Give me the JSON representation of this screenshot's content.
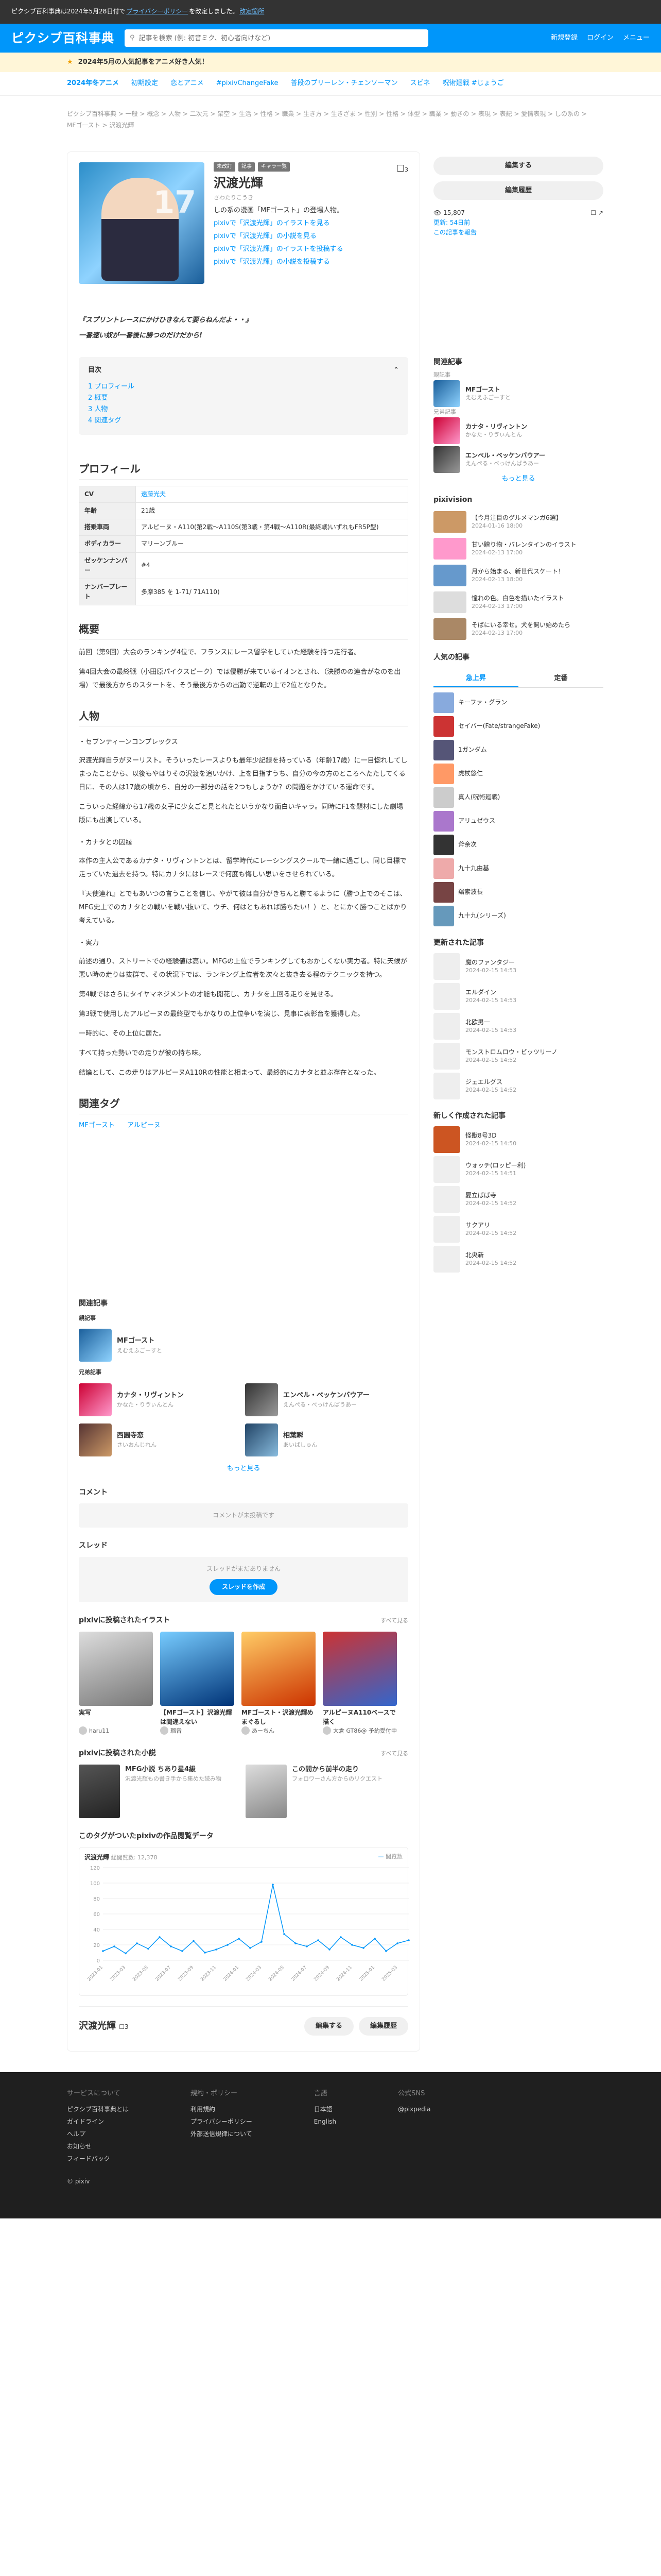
{
  "topbar": {
    "text1": "ピクシブ百科事典は2024年5月28日付で",
    "link1": "プライバシーポリシー",
    "text2": "を改定しました。",
    "link2": "改定箇所"
  },
  "header": {
    "logo": "ピクシブ百科事典",
    "search_placeholder": "記事を検索 (例: 初音ミク、初心者向けなど)",
    "links": [
      "新規登録",
      "ログイン",
      "メニュー"
    ]
  },
  "promo": "2024年5月の人気記事をアニメ好き人気！",
  "tags": [
    "2024年冬アニメ",
    "初期設定",
    "恋とアニメ",
    "#pixivChangeFake",
    "普段のプリーレン・チェンソーマン",
    "スビネ",
    "呪術廻戦 #じょうご"
  ],
  "breadcrumb": "ピクシブ百科事典 > 一般 > 概念 > 人物 > 二次元 > 架空 > 生活 > 性格 > 職業 > 生き方 > 生きざま > 性別 > 性格 > 体型 > 職業 > 動きの > 表現 > 表記 > 愛情表現 > しの系の > MFゴースト > 沢渡光輝",
  "article": {
    "chips": [
      "未改訂",
      "記事",
      "キャラ一覧"
    ],
    "title": "沢渡光輝",
    "reading": "さわたりこうき",
    "summary": "しの系の漫画「MFゴースト」の登場人物。",
    "links": [
      "pixivで「沢渡光輝」のイラストを見る",
      "pixivで「沢渡光輝」の小説を見る",
      "pixivで「沢渡光輝」のイラストを投稿する",
      "pixivで「沢渡光輝」の小説を投稿する"
    ],
    "bookmark_count": "3",
    "quote1": "『スプリントレースにかけひきなんて要らねんだよ・・』",
    "quote2": "一番速い奴が一番後に勝つのだけだから!",
    "toc_title": "目次",
    "toc": [
      "1 プロフィール",
      "2 概要",
      "3 人物",
      "4 関連タグ"
    ]
  },
  "profile": {
    "title": "プロフィール",
    "rows": [
      {
        "k": "CV",
        "v": "遠藤光夫"
      },
      {
        "k": "年齢",
        "v": "21歳"
      },
      {
        "k": "搭乗車両",
        "v": "アルピーヌ・A110(第2戦〜A110S(第3戦・第4戦〜A110R(最終戦)いずれもFR5P型)"
      },
      {
        "k": "ボディカラー",
        "v": "マリーンブルー"
      },
      {
        "k": "ゼッケンナンバー",
        "v": "#4"
      },
      {
        "k": "ナンバープレート",
        "v": "多摩385 を 1-71/ 71A110)"
      }
    ]
  },
  "overview": {
    "title": "概要",
    "p1": "前回（第9回）大会のランキング4位で、フランスにレース留学をしていた経験を持つ走行者。",
    "p2": "第4回大会の最終戦（小田原パイクスピーク）では優勝が来ているイオンとされ、（決勝のの連合がなのを出場）で最後方からのスタートを、そう最後方からの出勤で逆転の上で2位となりた。"
  },
  "character": {
    "title": "人物",
    "s1": "・セブンティーンコンプレックス",
    "p1": "沢渡光輝自ラがヌーリスト。そういったレースよりも最年少記録を持っている（年齢17歳）に一目惚れしてしまったことから、以後もやはりその沢渡を追いかけ、上を目指すうち、自分の今の方のところへたたしてくる日に、その人は17歳の頃から、自分の一部分の話を2つもしょうか？の問題をかけている運命です。",
    "p2": "こういった経緯から17歳の女子に少女ごと見とれたというかなり面白いキャラ。同時にF1を題材にした劇場版にも出演している。",
    "s2": "・カナタとの因縁",
    "p3": "本作の主人公であるカナタ・リヴィントンとは、留学時代にレーシングスクールで一緒に過ごし、同じ目標で走っていた過去を持つ。特にカナタにはレースで何度も悔しい思いをさせられている。",
    "p4": "『天使連れ』とでもあいつの言うことを信じ、やがて彼は自分がきちんと勝てるように（勝つ上でのそこは、MFG史上でのカナタとの戦いを戦い抜いて、ウチ、何はともあれば勝ちたい！）と、とにかく勝つことばかり考えている。",
    "s3": "・実力",
    "p5": "前述の通り、ストリートでの経験値は高い。MFGの上位でランキングしてもおかしくない実力者。特に天候が悪い時の走りは抜群で、その状況下では、ランキング上位者を次々と抜き去る程のテクニックを持つ。",
    "p6": "第4戦ではさらにタイヤマネジメントの才能も開花し、カナタを上回る走りを見せる。",
    "p7": "第3戦で使用したアルピーヌの最終型でもかなりの上位争いを演じ、見事に表彰台を獲得した。",
    "p8": "一時的に、その上位に居た。",
    "p9": "すべて持った勢いでの走りが彼の持ち味。",
    "p10": "結論として、この走りはアルピーヌA110Rの性能と相まって、最終的にカナタと並ぶ存在となった。"
  },
  "related": {
    "title": "関連タグ",
    "tags": [
      "MFゴースト",
      "アルピーヌ"
    ]
  },
  "related_articles": {
    "title": "関連記事",
    "parent_label": "親記事",
    "parent": {
      "name": "MFゴースト",
      "sub": "えむえふごーすと"
    },
    "sibling_label": "兄弟記事",
    "siblings": [
      {
        "name": "カナタ・リヴィントン",
        "sub": "かなた・りゔぃんとん"
      },
      {
        "name": "エンペル・ベッケンバウアー",
        "sub": "えんぺる・べっけんばうあー"
      },
      {
        "name": "西園寺恋",
        "sub": "さいおんじれん"
      },
      {
        "name": "相葉瞬",
        "sub": "あいばしゅん"
      }
    ],
    "more": "もっと見る"
  },
  "comments": {
    "title": "コメント",
    "empty": "コメントが未投稿です"
  },
  "thread": {
    "title": "スレッド",
    "empty": "スレッドがまだありません",
    "button": "スレッドを作成"
  },
  "illusts": {
    "title": "pixivに投稿されたイラスト",
    "more": "すべて見る",
    "items": [
      {
        "title": "実写",
        "user": "haru11"
      },
      {
        "title": "【MFゴースト】沢渡光輝は間違えない",
        "user": "瑠音"
      },
      {
        "title": "MFゴースト・沢渡光輝めまぐるし",
        "user": "あーちん"
      },
      {
        "title": "アルピーヌA110ベースで描く",
        "user": "大倉 GT86@ 予約受付中"
      }
    ]
  },
  "novels": {
    "title": "pixivに投稿された小説",
    "more": "すべて見る",
    "items": [
      {
        "title": "MFG小説 ちあり星4級",
        "meta": "沢渡光輝もの書き手から集めた読み物"
      },
      {
        "title": "この間から前半の走り",
        "meta": "フォロワーさん方からのリクエスト"
      }
    ]
  },
  "chart_title": "このタグがついたpixivの作品閲覧データ",
  "chart_data": {
    "type": "line",
    "title": "沢渡光輝",
    "legend_label": "総閲覧数: 12,378",
    "legend_right": "閲覧数",
    "ylim": [
      0,
      120
    ],
    "yticks": [
      0,
      20,
      40,
      60,
      80,
      100,
      120
    ],
    "x": [
      "2023-01",
      "2023-02",
      "2023-03",
      "2023-04",
      "2023-05",
      "2023-06",
      "2023-07",
      "2023-08",
      "2023-09",
      "2023-10",
      "2023-11",
      "2023-12",
      "2024-01",
      "2024-02",
      "2024-03",
      "2024-04",
      "2024-05",
      "2024-06",
      "2024-07",
      "2024-08",
      "2024-09",
      "2024-10",
      "2024-11",
      "2024-12",
      "2025-01",
      "2025-02",
      "2025-03",
      "2025-04"
    ],
    "values": [
      12,
      18,
      9,
      22,
      15,
      30,
      18,
      12,
      25,
      10,
      14,
      20,
      28,
      16,
      24,
      98,
      34,
      22,
      18,
      26,
      14,
      30,
      20,
      16,
      28,
      12,
      22,
      26
    ]
  },
  "bottom": {
    "title": "沢渡光輝",
    "count": "3",
    "edit": "編集する",
    "history": "編集履歴"
  },
  "side": {
    "edit": "編集する",
    "history": "編集履歴",
    "stats": [
      "15,807",
      "◆",
      "◆"
    ],
    "updated": "更新: 54日前",
    "report": "この記事を報告",
    "related_title": "関連記事",
    "parent_label": "親記事",
    "parent": {
      "name": "MFゴースト",
      "sub": "えむえふごーすと"
    },
    "sibs_label": "兄弟記事",
    "sibs": [
      {
        "name": "カナタ・リヴィントン",
        "sub": "かなた・りゔぃんとん"
      },
      {
        "name": "エンペル・ベッケンバウアー",
        "sub": "えんぺる・べっけんばうあー"
      }
    ],
    "more": "もっと見る",
    "news_title": "pixivision",
    "news": [
      {
        "t": "【今月注目のグルメマンガ6選】",
        "d": "2024-01-16 18:00"
      },
      {
        "t": "甘い贈り物・バレンタインのイラスト",
        "d": "2024-02-13 17:00"
      },
      {
        "t": "月から始まる、新世代スケート！",
        "d": "2024-02-13 18:00"
      },
      {
        "t": "憧れの色。白色を描いたイラスト",
        "d": "2024-02-13 17:00"
      },
      {
        "t": "そばにいる幸せ。犬を飼い始めたら",
        "d": "2024-02-13 17:00"
      }
    ],
    "rank_title": "人気の記事",
    "tabs": [
      "急上昇",
      "定番"
    ],
    "ranks": [
      "キーファ・グラン",
      "セイバー(Fate/strangeFake)",
      "1ガンダム",
      "虎杖悠仁",
      "真人(呪術廻戦)",
      "アリュゼウス",
      "斧余次",
      "九十九由基",
      "羂索波長",
      "九十九(シリーズ)"
    ],
    "upd_title": "更新された記事",
    "updates": [
      {
        "t": "魔のファンタジー",
        "d": "2024-02-15 14:53"
      },
      {
        "t": "エルダイン",
        "d": "2024-02-15 14:53"
      },
      {
        "t": "北欧男一",
        "d": "2024-02-15 14:53"
      },
      {
        "t": "モンストロムロウ・ビッツリーノ",
        "d": "2024-02-15 14:52"
      },
      {
        "t": "ジェエルグス",
        "d": "2024-02-15 14:52"
      }
    ],
    "new_title": "新しく作成された記事",
    "news_created": [
      {
        "t": "怪獣8号3D",
        "d": "2024-02-15 14:50"
      },
      {
        "t": "ウォッチ(ロッピー利)",
        "d": "2024-02-15 14:51"
      },
      {
        "t": "夏立ばば寺",
        "d": "2024-02-15 14:52"
      },
      {
        "t": "サクアリ",
        "d": "2024-02-15 14:52"
      },
      {
        "t": "北央新",
        "d": "2024-02-15 14:52"
      }
    ]
  },
  "footer": {
    "cols": [
      {
        "h": "サービスについて",
        "items": [
          "ピクシブ百科事典とは",
          "ガイドライン",
          "ヘルプ",
          "お知らせ",
          "フィードバック"
        ]
      },
      {
        "h": "規約・ポリシー",
        "items": [
          "利用規約",
          "プライバシーポリシー",
          "外部送信規律について"
        ]
      },
      {
        "h": "言語",
        "items": [
          "日本語",
          "English"
        ]
      },
      {
        "h": "公式SNS",
        "items": [
          "@pixpedia"
        ]
      }
    ],
    "copyright": "© pixiv"
  }
}
